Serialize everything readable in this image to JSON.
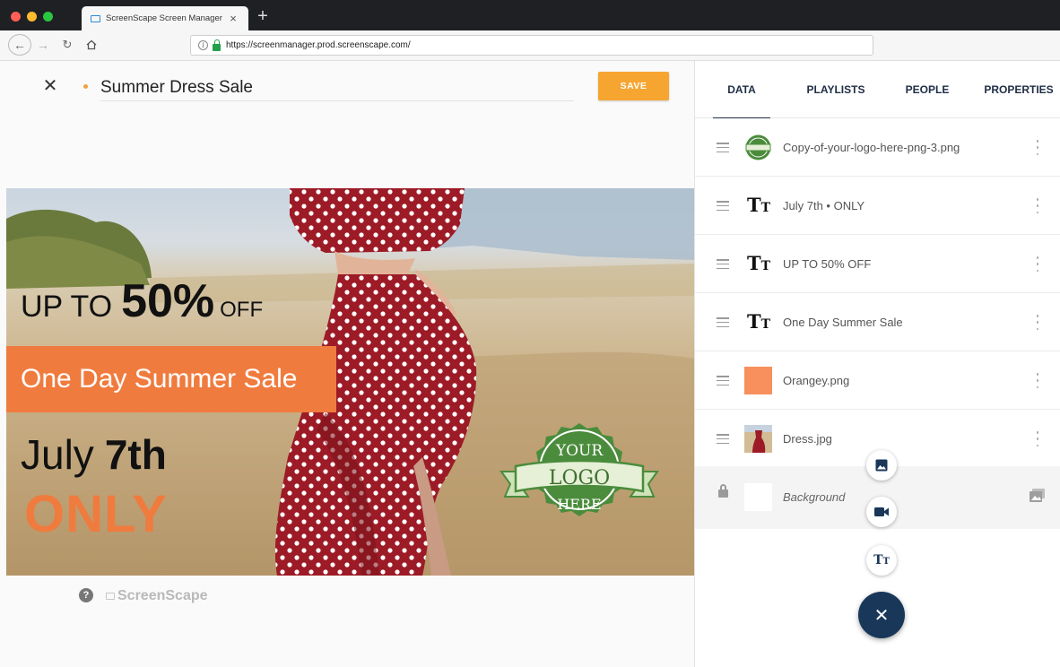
{
  "browser": {
    "tab_title": "ScreenScape Screen Manager",
    "url": "https://screenmanager.prod.screenscape.com/"
  },
  "editor": {
    "title": "Summer Dress Sale",
    "save_label": "SAVE",
    "footer_brand": "ScreenScape",
    "help_glyph": "?"
  },
  "canvas": {
    "up_to": "UP TO",
    "percent": "50%",
    "off": "OFF",
    "band_text": "One Day Summer Sale",
    "july": "July",
    "day": "7th",
    "only": "ONLY",
    "logo": {
      "line1": "YOUR",
      "line2": "LOGO",
      "line3": "HERE"
    }
  },
  "panel": {
    "tabs": [
      {
        "label": "DATA",
        "active": true
      },
      {
        "label": "PLAYLISTS",
        "active": false
      },
      {
        "label": "PEOPLE",
        "active": false
      },
      {
        "label": "PROPERTIES",
        "active": false
      }
    ],
    "layers": [
      {
        "name": "Copy-of-your-logo-here-png-3.png",
        "kind": "image"
      },
      {
        "name": "July 7th • ONLY",
        "kind": "text"
      },
      {
        "name": "UP TO 50% OFF",
        "kind": "text"
      },
      {
        "name": "One Day Summer Sale",
        "kind": "text"
      },
      {
        "name": "Orangey.png",
        "kind": "image"
      },
      {
        "name": "Dress.jpg",
        "kind": "image"
      }
    ],
    "background_label": "Background"
  },
  "icons": {
    "close": "close-icon",
    "text_layer": "text-type-icon",
    "drag": "drag-handle-icon",
    "more": "more-vert-icon",
    "lock": "lock-icon",
    "image": "image-icon",
    "video": "video-icon",
    "fab_close": "close-icon"
  },
  "colors": {
    "accent_orange": "#f6a531",
    "promo_orange": "#f07b3e",
    "navy": "#183759",
    "logo_green": "#4b8c3c"
  }
}
